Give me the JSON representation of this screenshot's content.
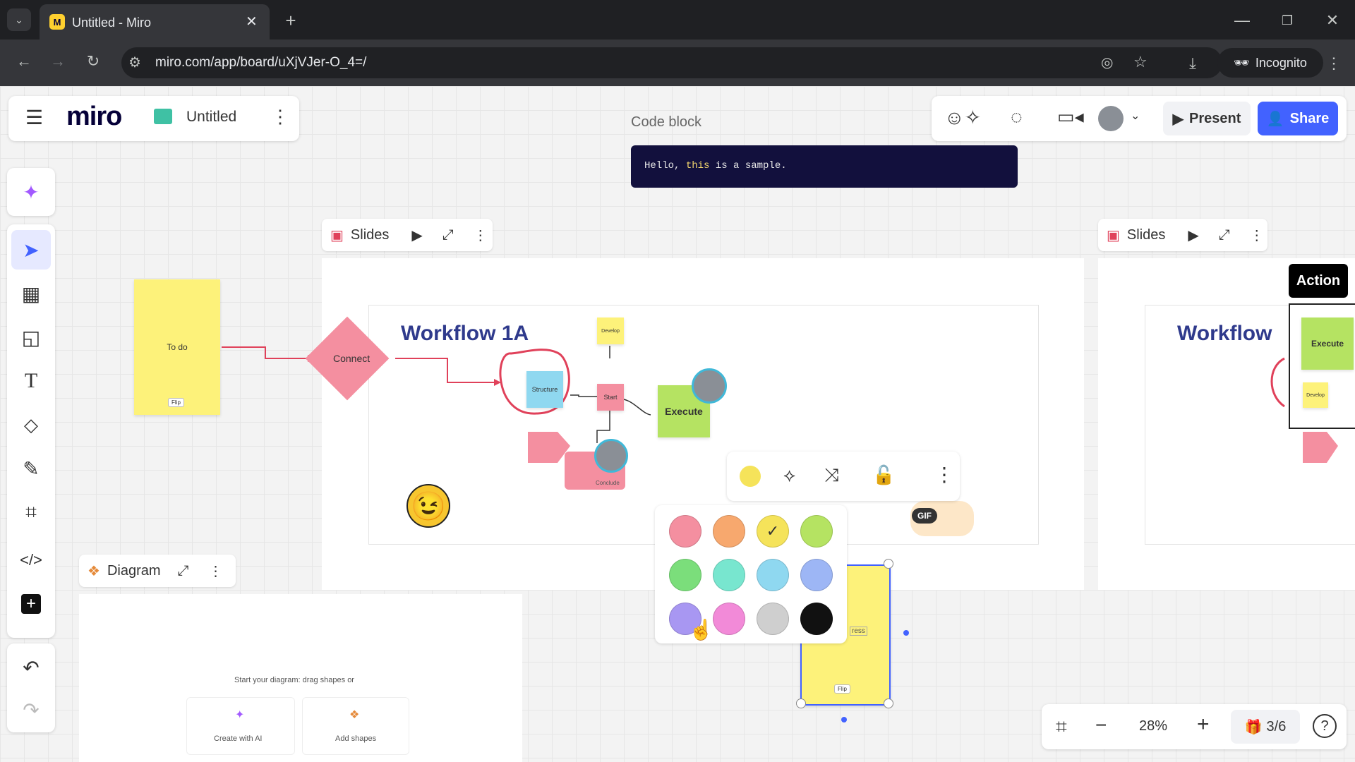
{
  "browser": {
    "tab_title": "Untitled - Miro",
    "url": "miro.com/app/board/uXjVJer-O_4=/",
    "incognito_label": "Incognito"
  },
  "board": {
    "logo": "miro",
    "title": "Untitled",
    "present_label": "Present",
    "share_label": "Share"
  },
  "code_block": {
    "label": "Code block",
    "code_prefix": "Hello, ",
    "code_keyword": "this",
    "code_suffix": " is a sample."
  },
  "frames": {
    "slides_left_label": "Slides",
    "slides_right_label": "Slides",
    "diagram_label": "Diagram",
    "action_label": "Action"
  },
  "workflow": {
    "title": "Workflow 1A",
    "title_right": "Workflow",
    "connect": "Connect",
    "structure": "Structure",
    "start": "Start",
    "execute": "Execute",
    "conclude": "Conclude",
    "develop": "Develop",
    "todo": "To do",
    "flip": "Flip",
    "in_progress_partial": "ress",
    "execute_right": "Execute",
    "develop_right": "Develop"
  },
  "diagram": {
    "prompt": "Start your diagram: drag shapes or",
    "create_ai": "Create with AI",
    "add_shapes": "Add shapes"
  },
  "context_toolbar": {
    "gif_label": "GIF"
  },
  "color_palette": {
    "swatches": [
      "#f48fa0",
      "#f7a86e",
      "#f5e35a",
      "#b5e362",
      "#7bde7b",
      "#78e6cf",
      "#8fd8f0",
      "#9db6f5",
      "#a897f2",
      "#f28ad8",
      "#cfcfcf",
      "#111111"
    ],
    "selected": "#f5e35a"
  },
  "zoom": {
    "level": "28%",
    "pages": "3/6"
  },
  "colors": {
    "accent": "#4262ff",
    "sticky_yellow": "#fdf27a",
    "connector_red": "#e0415a"
  }
}
